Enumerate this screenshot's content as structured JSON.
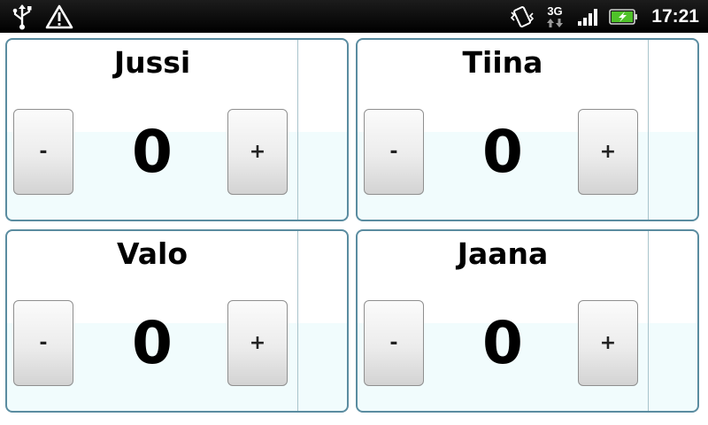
{
  "status_bar": {
    "icons": [
      "usb-icon",
      "warning-icon",
      "vibrate-icon",
      "3g-icon",
      "signal-icon",
      "battery-charging-icon"
    ],
    "network_label": "3G",
    "time": "17:21"
  },
  "players": [
    {
      "name": "Jussi",
      "score": "0",
      "minus_label": "-",
      "plus_label": "+"
    },
    {
      "name": "Tiina",
      "score": "0",
      "minus_label": "-",
      "plus_label": "+"
    },
    {
      "name": "Valo",
      "score": "0",
      "minus_label": "-",
      "plus_label": "+"
    },
    {
      "name": "Jaana",
      "score": "0",
      "minus_label": "-",
      "plus_label": "+"
    }
  ],
  "colors": {
    "card_border": "#5a8ca0",
    "card_lower_bg": "#f1fcfd",
    "status_bar_bg": "#000000",
    "battery_fill": "#4fc229"
  }
}
